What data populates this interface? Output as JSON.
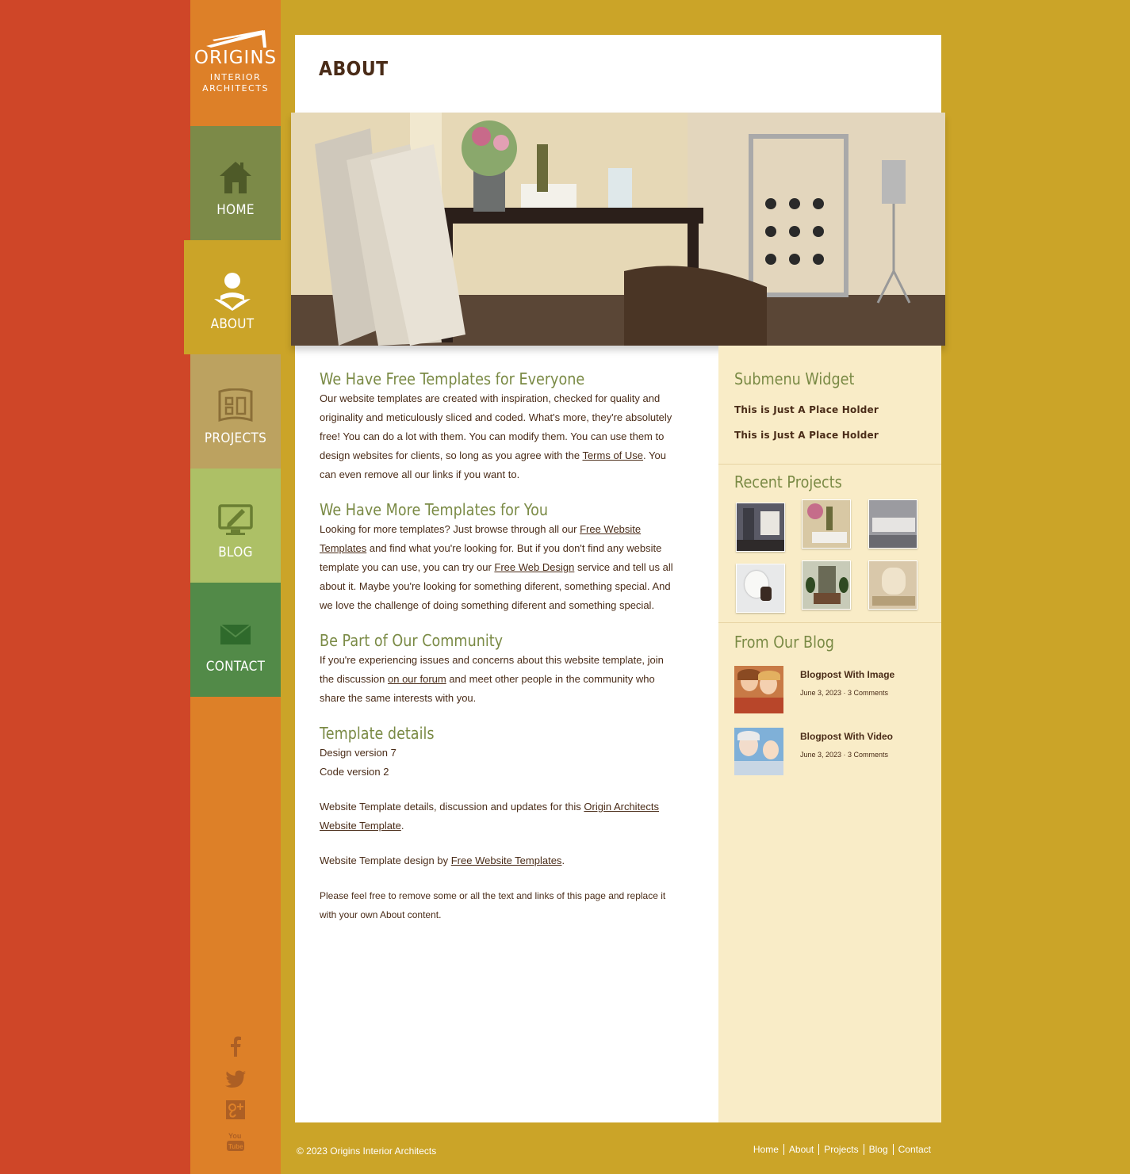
{
  "brand": {
    "name": "ORIGINS",
    "tagline_line1": "INTERIOR",
    "tagline_line2": "ARCHITECTS"
  },
  "nav": {
    "home": "HOME",
    "about": "ABOUT",
    "projects": "PROJECTS",
    "blog": "BLOG",
    "contact": "CONTACT",
    "active": "about"
  },
  "social": [
    "facebook-icon",
    "twitter-icon",
    "google-plus-icon",
    "youtube-icon"
  ],
  "page": {
    "title": "ABOUT"
  },
  "content": {
    "s1_title": "We Have Free Templates for Everyone",
    "s1_text_a": "Our website templates are created with inspiration, checked for quality and originality and meticulously sliced and coded. What's more, they're absolutely free! You can do a lot with them. You can modify them. You can use them to design websites for clients, so long as you agree with the ",
    "s1_link": "Terms of Use",
    "s1_text_b": ". You can even remove all our links if you want to.",
    "s2_title": "We Have More Templates for You",
    "s2_text_a": "Looking for more templates? Just browse through all our ",
    "s2_link1": "Free Website Templates",
    "s2_text_b": " and find what you're looking for. But if you don't find any website template you can use, you can try our ",
    "s2_link2": "Free Web Design",
    "s2_text_c": " service and tell us all about it. Maybe you're looking for something diferent, something special. And we love the challenge of doing something diferent and something special.",
    "s3_title": "Be Part of Our Community",
    "s3_text_a": "If you're experiencing issues and concerns about this website template, join the discussion ",
    "s3_link": "on our forum",
    "s3_text_b": " and meet other people in the community who share the same interests with you.",
    "s4_title": "Template details",
    "design_version": "Design version 7",
    "code_version": "Code version 2",
    "details_text_a": "Website Template details, discussion and updates for this ",
    "details_link": "Origin Architects Website Template",
    "details_text_b": ".",
    "design_by_text": "Website Template design by ",
    "design_by_link": "Free Website Templates",
    "design_by_end": ".",
    "note": "Please feel free to remove some or all the text and links of this page and replace it with your own About content."
  },
  "sidebar": {
    "submenu_title": "Submenu Widget",
    "submenu_items": [
      "This is Just A Place Holder",
      "This is Just A Place Holder"
    ],
    "projects_title": "Recent Projects",
    "blog_title": "From Our Blog",
    "posts": [
      {
        "title": "Blogpost With Image",
        "meta": "June 3, 2023 · 3 Comments"
      },
      {
        "title": "Blogpost With Video",
        "meta": "June 3, 2023 · 3 Comments"
      }
    ]
  },
  "footer": {
    "copyright": "© 2023 Origins Interior Architects",
    "links": [
      "Home",
      "About",
      "Projects",
      "Blog",
      "Contact"
    ]
  }
}
